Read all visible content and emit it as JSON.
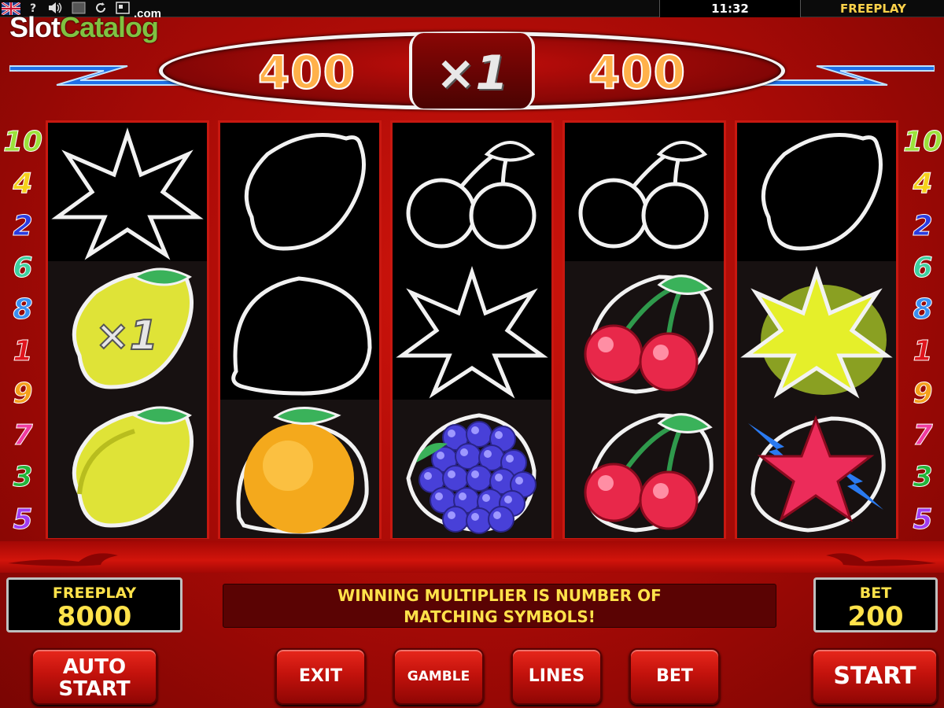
{
  "topbar": {
    "help_label": "?",
    "clock": "11:32",
    "mode": "FREEPLAY"
  },
  "watermark": {
    "part1": "Slot",
    "part2": "Catalog",
    "part3": ".com"
  },
  "win_display": {
    "left_value": "400",
    "multiplier": "×1",
    "right_value": "400"
  },
  "paylines": {
    "left": [
      {
        "n": "10",
        "color": "#9be23b"
      },
      {
        "n": "4",
        "color": "#f5d21c"
      },
      {
        "n": "2",
        "color": "#2a3ce0"
      },
      {
        "n": "6",
        "color": "#3fd0a0"
      },
      {
        "n": "8",
        "color": "#3a8ef0"
      },
      {
        "n": "1",
        "color": "#e0141c"
      },
      {
        "n": "9",
        "color": "#f5a01c"
      },
      {
        "n": "7",
        "color": "#f03ca0"
      },
      {
        "n": "3",
        "color": "#22b53a"
      },
      {
        "n": "5",
        "color": "#a03cf0"
      }
    ],
    "right": [
      {
        "n": "10",
        "color": "#9be23b"
      },
      {
        "n": "4",
        "color": "#f5d21c"
      },
      {
        "n": "2",
        "color": "#2a3ce0"
      },
      {
        "n": "6",
        "color": "#3fd0a0"
      },
      {
        "n": "8",
        "color": "#3a8ef0"
      },
      {
        "n": "1",
        "color": "#e0141c"
      },
      {
        "n": "9",
        "color": "#f5a01c"
      },
      {
        "n": "7",
        "color": "#f03ca0"
      },
      {
        "n": "3",
        "color": "#22b53a"
      },
      {
        "n": "5",
        "color": "#a03cf0"
      }
    ]
  },
  "reels": [
    [
      "star-outline",
      "lemon-multiplier",
      "lemon"
    ],
    [
      "lemon-outline",
      "orange-outline",
      "orange"
    ],
    [
      "cherry-outline",
      "star-outline",
      "grapes"
    ],
    [
      "cherry-outline",
      "cherry",
      "cherry"
    ],
    [
      "lemon-outline",
      "star-yellow",
      "star-red"
    ]
  ],
  "lemon_multiplier_label": "×1",
  "meters": {
    "balance_label": "FREEPLAY",
    "balance_value": "8000",
    "bet_label": "BET",
    "bet_value": "200"
  },
  "message": {
    "line1": "WINNING MULTIPLIER IS NUMBER OF",
    "line2": "MATCHING SYMBOLS!"
  },
  "buttons": {
    "autostart_line1": "AUTO",
    "autostart_line2": "START",
    "exit": "EXIT",
    "gamble": "GAMBLE",
    "lines": "LINES",
    "bet": "BET",
    "start": "START"
  },
  "colors": {
    "accent_yellow": "#ffe24a",
    "win_orange": "#ffb14a",
    "reel_border": "#c81810",
    "background_red": "#c8120a"
  }
}
